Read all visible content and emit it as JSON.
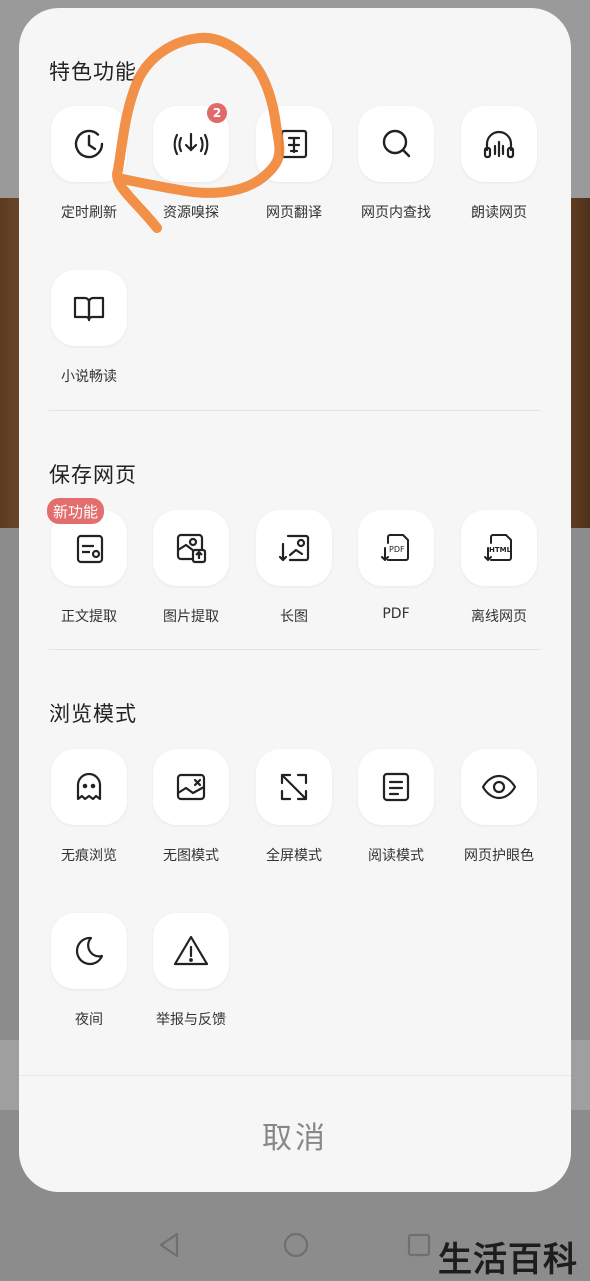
{
  "sections": {
    "featured": {
      "title": "特色功能"
    },
    "save": {
      "title": "保存网页"
    },
    "browse": {
      "title": "浏览模式"
    }
  },
  "featured_items": [
    {
      "label": "定时刷新",
      "icon": "clock-refresh-icon"
    },
    {
      "label": "资源嗅探",
      "icon": "sniff-icon",
      "badge": "2"
    },
    {
      "label": "网页翻译",
      "icon": "translate-icon"
    },
    {
      "label": "网页内查找",
      "icon": "search-icon"
    },
    {
      "label": "朗读网页",
      "icon": "headphones-icon"
    },
    {
      "label": "小说畅读",
      "icon": "book-icon"
    }
  ],
  "save_items": [
    {
      "label": "正文提取",
      "icon": "text-extract-icon",
      "tag": "新功能"
    },
    {
      "label": "图片提取",
      "icon": "image-extract-icon"
    },
    {
      "label": "长图",
      "icon": "long-image-icon"
    },
    {
      "label": "PDF",
      "icon": "pdf-icon",
      "icon_text": "PDF"
    },
    {
      "label": "离线网页",
      "icon": "html-icon",
      "icon_text": "HTML"
    }
  ],
  "browse_items": [
    {
      "label": "无痕浏览",
      "icon": "ghost-icon"
    },
    {
      "label": "无图模式",
      "icon": "no-image-icon"
    },
    {
      "label": "全屏模式",
      "icon": "fullscreen-icon"
    },
    {
      "label": "阅读模式",
      "icon": "reading-mode-icon"
    },
    {
      "label": "网页护眼色",
      "icon": "eye-icon"
    },
    {
      "label": "夜间",
      "icon": "moon-icon"
    },
    {
      "label": "举报与反馈",
      "icon": "warning-icon"
    }
  ],
  "cancel_label": "取消",
  "watermark": "生活百科",
  "colors": {
    "accent_badge": "#e06a6a",
    "annotation": "#f08a3c",
    "sheet_bg": "#f6f6f6"
  }
}
